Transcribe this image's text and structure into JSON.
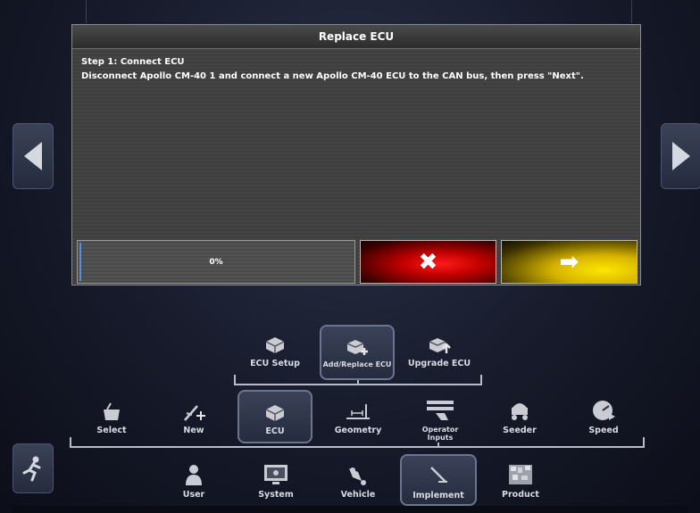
{
  "dialog": {
    "title": "Replace ECU",
    "step": "Step 1: Connect ECU",
    "instruction": "Disconnect Apollo CM-40 1 and connect a new Apollo CM-40 ECU to the CAN bus, then press \"Next\".",
    "progress_text": "0%",
    "progress_value": 0,
    "cancel_icon": "x-icon",
    "next_icon": "arrow-right-icon",
    "cancel_color": "#e00000",
    "next_color": "#ffd800"
  },
  "ecu_menu": [
    {
      "label": "ECU Setup",
      "icon": "ecu-icon"
    },
    {
      "label": "Add/Replace ECU",
      "icon": "ecu-add-icon",
      "selected": true
    },
    {
      "label": "Upgrade ECU",
      "icon": "ecu-upgrade-icon"
    }
  ],
  "implement_menu": [
    {
      "label": "Select",
      "icon": "basket-icon"
    },
    {
      "label": "New",
      "icon": "new-implement-icon"
    },
    {
      "label": "ECU",
      "icon": "ecu-icon",
      "selected": true
    },
    {
      "label": "Geometry",
      "icon": "geometry-icon"
    },
    {
      "label": "Operator Inputs",
      "icon": "operator-inputs-icon"
    },
    {
      "label": "Seeder",
      "icon": "seeder-icon"
    },
    {
      "label": "Speed",
      "icon": "speed-icon"
    }
  ],
  "main_menu": [
    {
      "label": "User",
      "icon": "user-icon"
    },
    {
      "label": "System",
      "icon": "system-icon"
    },
    {
      "label": "Vehicle",
      "icon": "vehicle-icon"
    },
    {
      "label": "Implement",
      "icon": "implement-icon",
      "selected": true
    },
    {
      "label": "Product",
      "icon": "product-icon"
    }
  ],
  "nav": {
    "left_arrow": "arrow-left-icon",
    "right_arrow": "arrow-right-icon",
    "run_icon": "running-man-icon"
  }
}
